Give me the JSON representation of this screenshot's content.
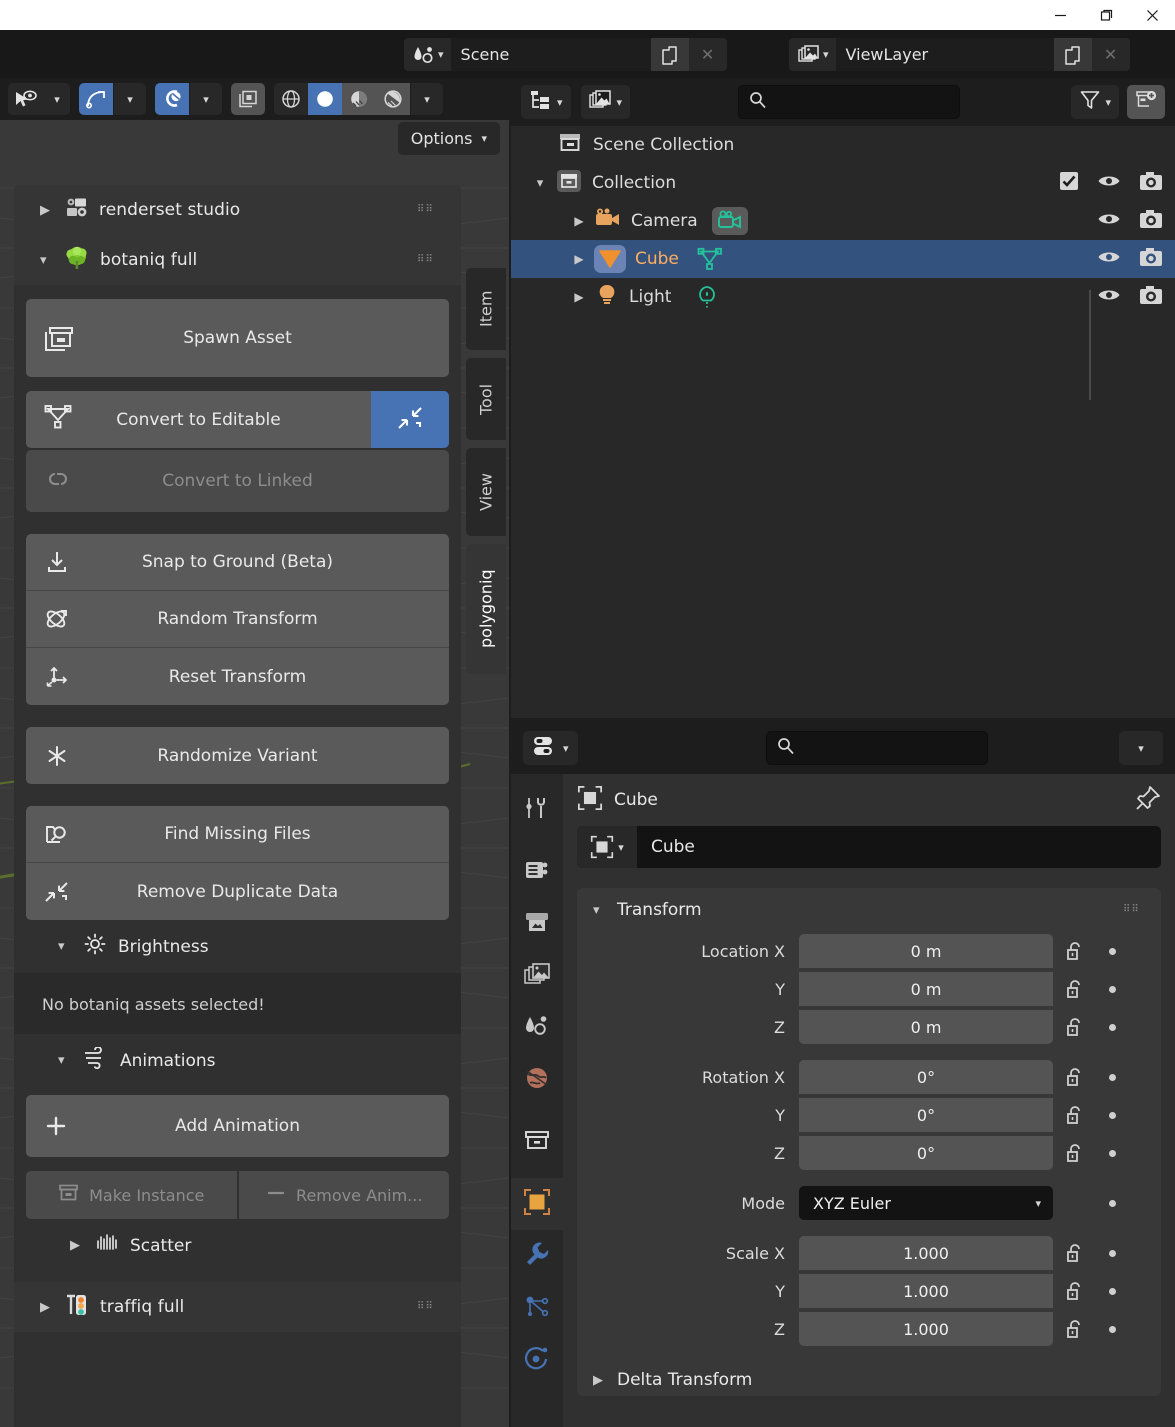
{
  "window": {
    "minimize_label": "minimize-window",
    "maximize_label": "restore-window",
    "close_label": "close-window"
  },
  "topbar": {
    "scene": {
      "icon": "scene-icon",
      "value": "Scene",
      "copy_icon": "new-scene-icon",
      "close_icon": "unlink-scene-icon"
    },
    "viewlayer": {
      "icon": "viewlayer-icon",
      "value": "ViewLayer",
      "copy_icon": "new-viewlayer-icon",
      "close_icon": "remove-viewlayer-icon"
    }
  },
  "viewport": {
    "header": {
      "mode_icon": "object-mode-icon",
      "transform_orientation_icon": "transform-pivot-icon",
      "snap_icon": "snap-magnet-icon",
      "proportional_icon": "proportional-editing-icon",
      "shading": [
        "wireframe-shading-icon",
        "solid-shading-icon",
        "material-preview-icon",
        "rendered-shading-icon"
      ],
      "active_shading_index": 1
    },
    "options_label": "Options"
  },
  "sidebar": {
    "tabs": [
      {
        "label": "Item",
        "active": false
      },
      {
        "label": "Tool",
        "active": false
      },
      {
        "label": "View",
        "active": false
      },
      {
        "label": "polygoniq",
        "active": true
      }
    ],
    "panels": [
      {
        "name": "renderset studio",
        "icon": "renderset-icon",
        "expanded": false
      },
      {
        "name": "botaniq full",
        "icon": "botaniq-tree-icon",
        "expanded": true
      },
      {
        "name": "traffiq full",
        "icon": "traffiq-icon",
        "expanded": false
      }
    ],
    "botaniq": {
      "spawn_asset": {
        "label": "Spawn Asset",
        "icon": "asset-box-icon"
      },
      "convert_editable": {
        "label": "Convert to Editable",
        "icon": "mesh-data-icon",
        "accent_icon": "collapse-arrows-icon"
      },
      "convert_linked": {
        "label": "Convert to Linked",
        "icon": "link-icon",
        "disabled": true
      },
      "transform_group": [
        {
          "label": "Snap to Ground (Beta)",
          "icon": "snap-down-icon"
        },
        {
          "label": "Random Transform",
          "icon": "random-transform-icon"
        },
        {
          "label": "Reset Transform",
          "icon": "reset-transform-icon"
        }
      ],
      "randomize_variant": {
        "label": "Randomize Variant",
        "icon": "asterisk-icon"
      },
      "file_group": [
        {
          "label": "Find Missing Files",
          "icon": "find-files-icon"
        },
        {
          "label": "Remove Duplicate Data",
          "icon": "collapse-arrows-icon"
        }
      ],
      "brightness": {
        "label": "Brightness",
        "icon": "sun-icon",
        "expanded": true
      },
      "no_assets_note": "No botaniq assets selected!",
      "animations": {
        "label": "Animations",
        "icon": "wind-icon",
        "expanded": true,
        "add_animation": {
          "label": "Add Animation",
          "icon": "plus-icon"
        },
        "make_instance": {
          "label": "Make Instance",
          "icon": "asset-box-icon",
          "disabled": true
        },
        "remove_animation": {
          "label": "Remove Anim...",
          "icon": "minus-icon",
          "disabled": true
        }
      },
      "scatter": {
        "label": "Scatter",
        "icon": "scatter-icon",
        "expanded": false
      }
    }
  },
  "outliner": {
    "header": {
      "display_mode_icon": "outliner-display-mode-icon",
      "filter_id_icon": "id-type-filter-icon",
      "search_icon": "search-icon",
      "search_value": "",
      "filter_icon": "funnel-filter-icon",
      "new_collection_icon": "new-collection-icon"
    },
    "rows": [
      {
        "name": "Scene Collection",
        "icon": "scene-collection-icon",
        "depth": 0,
        "expander": "none",
        "selected": false,
        "checkbox": false,
        "eye": false,
        "camera": false
      },
      {
        "name": "Collection",
        "icon": "collection-icon",
        "depth": 1,
        "expander": "down",
        "selected": false,
        "checkbox": true,
        "eye": true,
        "camera": true
      },
      {
        "name": "Camera",
        "icon": "camera-object-icon",
        "data_icon": "camera-data-icon",
        "depth": 2,
        "expander": "right",
        "selected": false,
        "checkbox": false,
        "eye": true,
        "camera": true
      },
      {
        "name": "Cube",
        "icon": "mesh-object-icon",
        "data_icon": "mesh-data-icon",
        "depth": 2,
        "expander": "right",
        "selected": true,
        "checkbox": false,
        "eye": true,
        "camera": true
      },
      {
        "name": "Light",
        "icon": "light-object-icon",
        "data_icon": "light-data-icon",
        "depth": 2,
        "expander": "right",
        "selected": false,
        "checkbox": false,
        "eye": true,
        "camera": true
      }
    ]
  },
  "properties": {
    "header": {
      "editor_type_icon": "properties-editor-icon",
      "search_icon": "search-icon",
      "search_value": "",
      "dropdown_icon": "chevron-down-icon"
    },
    "tabs": [
      {
        "name": "tool",
        "icon": "tool-tab-icon",
        "active": false
      },
      {
        "name": "render",
        "icon": "render-tab-icon",
        "active": false
      },
      {
        "name": "output",
        "icon": "output-tab-icon",
        "active": false
      },
      {
        "name": "view-layer",
        "icon": "viewlayer-tab-icon",
        "active": false
      },
      {
        "name": "scene",
        "icon": "scene-tab-icon",
        "active": false
      },
      {
        "name": "world",
        "icon": "world-tab-icon",
        "active": false
      },
      {
        "name": "collection",
        "icon": "collection-tab-icon",
        "active": false
      },
      {
        "name": "object",
        "icon": "object-tab-icon",
        "active": true
      },
      {
        "name": "modifiers",
        "icon": "wrench-tab-icon",
        "active": false
      },
      {
        "name": "particles",
        "icon": "particles-tab-icon",
        "active": false
      },
      {
        "name": "physics",
        "icon": "physics-tab-icon",
        "active": false
      }
    ],
    "breadcrumb": {
      "icon": "object-tab-icon",
      "label": "Cube",
      "pin_icon": "pin-icon"
    },
    "object_name": {
      "icon": "object-tab-icon",
      "value": "Cube"
    },
    "transform": {
      "title": "Transform",
      "expanded": true,
      "location": {
        "label": "Location X",
        "axes": [
          "X",
          "Y",
          "Z"
        ],
        "values": [
          "0 m",
          "0 m",
          "0 m"
        ]
      },
      "rotation": {
        "label": "Rotation X",
        "axes": [
          "X",
          "Y",
          "Z"
        ],
        "values": [
          "0°",
          "0°",
          "0°"
        ]
      },
      "mode": {
        "label": "Mode",
        "value": "XYZ Euler"
      },
      "scale": {
        "label": "Scale X",
        "axes": [
          "X",
          "Y",
          "Z"
        ],
        "values": [
          "1.000",
          "1.000",
          "1.000"
        ]
      },
      "lock_icon": "unlocked-padlock-icon",
      "animate_icon": "animate-property-dot-icon"
    },
    "delta_transform": {
      "title": "Delta Transform",
      "expanded": false
    }
  },
  "colors": {
    "accent_blue": "#4772b3",
    "selection_blue": "#33527e",
    "panel_bg": "#303030",
    "header_bg": "#1d1d1d",
    "field_bg": "#545454",
    "text": "#e9e9e9",
    "orange": "#ffae5e"
  }
}
